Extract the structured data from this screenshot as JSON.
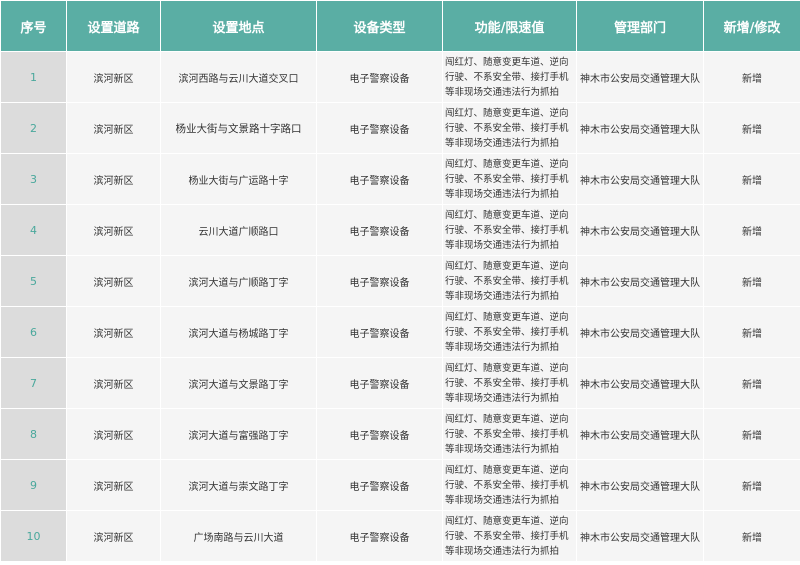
{
  "headers": [
    "序号",
    "设置道路",
    "设置地点",
    "设备类型",
    "功能/限速值",
    "管理部门",
    "新增/修改"
  ],
  "rows": [
    {
      "no": "1",
      "road": "滨河新区",
      "location": "滨河西路与云川大道交叉口",
      "device": "电子警察设备",
      "function": "闯红灯、随意变更车道、逆向行驶、不系安全带、接打手机等非现场交通违法行为抓拍",
      "dept": "神木市公安局交通管理大队",
      "status": "新增"
    },
    {
      "no": "2",
      "road": "滨河新区",
      "location": "杨业大街与文景路十字路口",
      "device": "电子警察设备",
      "function": "闯红灯、随意变更车道、逆向行驶、不系安全带、接打手机等非现场交通违法行为抓拍",
      "dept": "神木市公安局交通管理大队",
      "status": "新增"
    },
    {
      "no": "3",
      "road": "滨河新区",
      "location": "杨业大街与广运路十字",
      "device": "电子警察设备",
      "function": "闯红灯、随意变更车道、逆向行驶、不系安全带、接打手机等非现场交通违法行为抓拍",
      "dept": "神木市公安局交通管理大队",
      "status": "新增"
    },
    {
      "no": "4",
      "road": "滨河新区",
      "location": "云川大道广顺路口",
      "device": "电子警察设备",
      "function": "闯红灯、随意变更车道、逆向行驶、不系安全带、接打手机等非现场交通违法行为抓拍",
      "dept": "神木市公安局交通管理大队",
      "status": "新增"
    },
    {
      "no": "5",
      "road": "滨河新区",
      "location": "滨河大道与广顺路丁字",
      "device": "电子警察设备",
      "function": "闯红灯、随意变更车道、逆向行驶、不系安全带、接打手机等非现场交通违法行为抓拍",
      "dept": "神木市公安局交通管理大队",
      "status": "新增"
    },
    {
      "no": "6",
      "road": "滨河新区",
      "location": "滨河大道与杨城路丁字",
      "device": "电子警察设备",
      "function": "闯红灯、随意变更车道、逆向行驶、不系安全带、接打手机等非现场交通违法行为抓拍",
      "dept": "神木市公安局交通管理大队",
      "status": "新增"
    },
    {
      "no": "7",
      "road": "滨河新区",
      "location": "滨河大道与文景路丁字",
      "device": "电子警察设备",
      "function": "闯红灯、随意变更车道、逆向行驶、不系安全带、接打手机等非现场交通违法行为抓拍",
      "dept": "神木市公安局交通管理大队",
      "status": "新增"
    },
    {
      "no": "8",
      "road": "滨河新区",
      "location": "滨河大道与富强路丁字",
      "device": "电子警察设备",
      "function": "闯红灯、随意变更车道、逆向行驶、不系安全带、接打手机等非现场交通违法行为抓拍",
      "dept": "神木市公安局交通管理大队",
      "status": "新增"
    },
    {
      "no": "9",
      "road": "滨河新区",
      "location": "滨河大道与崇文路丁字",
      "device": "电子警察设备",
      "function": "闯红灯、随意变更车道、逆向行驶、不系安全带、接打手机等非现场交通违法行为抓拍",
      "dept": "神木市公安局交通管理大队",
      "status": "新增"
    },
    {
      "no": "10",
      "road": "滨河新区",
      "location": "广场南路与云川大道",
      "device": "电子警察设备",
      "function": "闯红灯、随意变更车道、逆向行驶、不系安全带、接打手机等非现场交通违法行为抓拍",
      "dept": "神木市公安局交通管理大队",
      "status": "新增"
    }
  ],
  "colors": {
    "header_bg": "#5aaea4",
    "header_text": "#ffffff",
    "index_bg": "#dcdcdc",
    "index_text": "#4aa89c",
    "cell_bg": "#f5f5f5"
  }
}
